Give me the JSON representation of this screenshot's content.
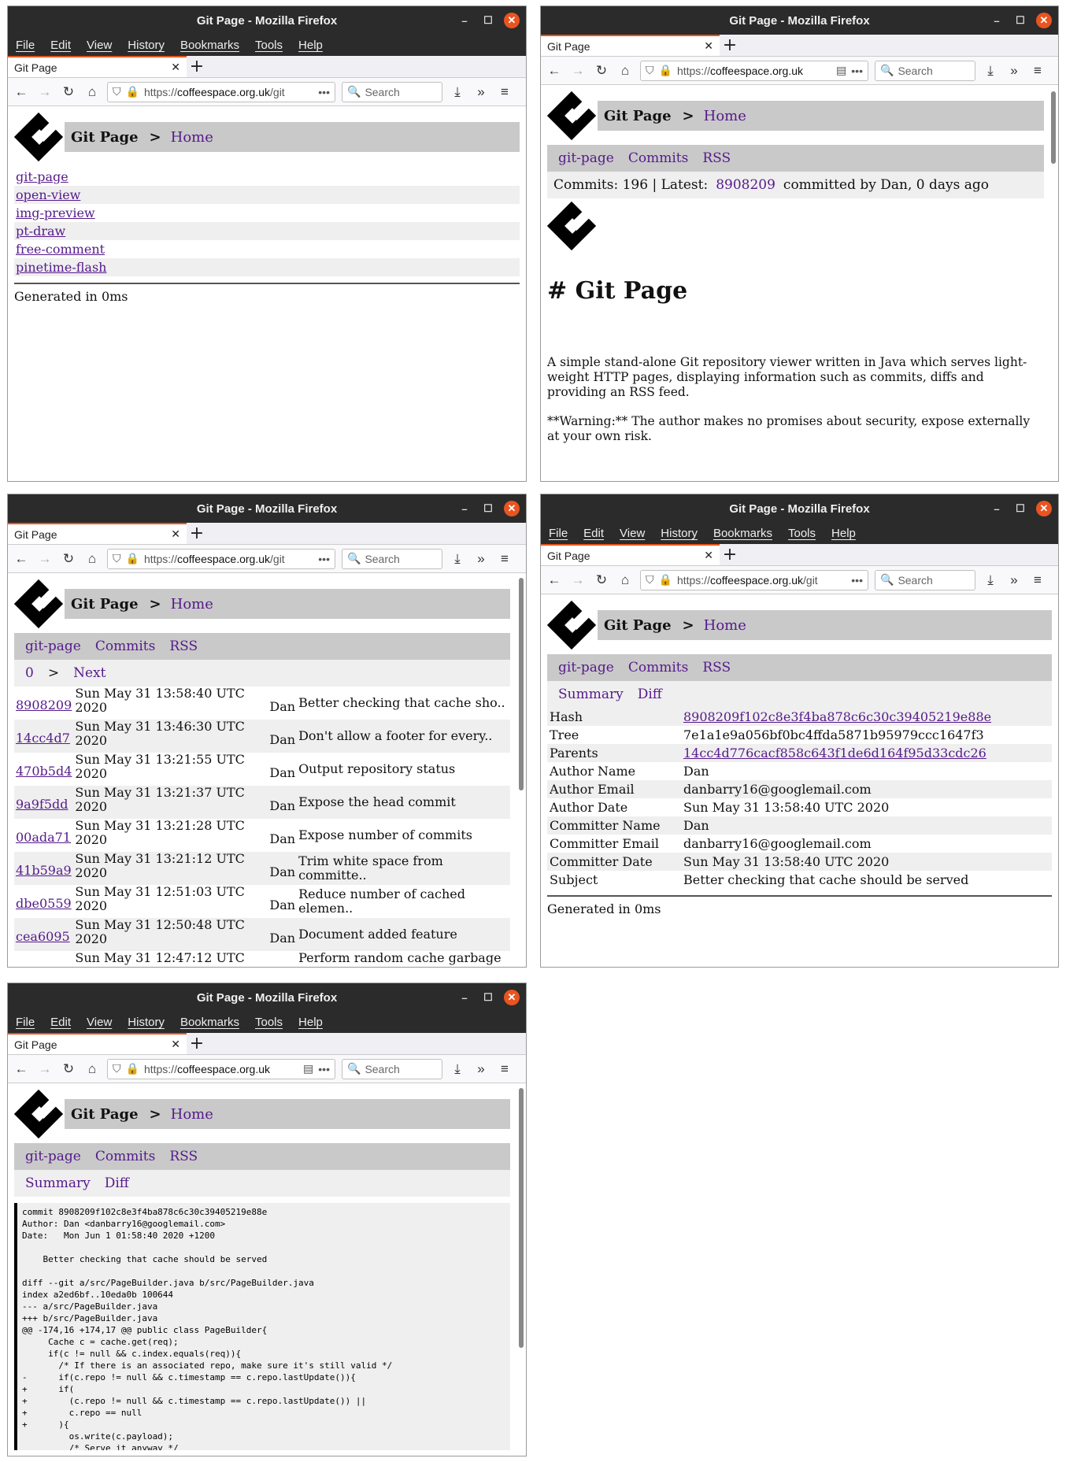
{
  "browser": {
    "window_title": "Git Page - Mozilla Firefox",
    "menu": [
      "File",
      "Edit",
      "View",
      "History",
      "Bookmarks",
      "Tools",
      "Help"
    ],
    "tab_title": "Git Page",
    "url_prefix": "https://",
    "url_host": "coffeespace.org.uk",
    "url_path": "/git",
    "search_placeholder": "Search",
    "accent_color": "#e95420"
  },
  "site": {
    "brand": "Git Page",
    "sep": ">",
    "home": "Home",
    "generated": "Generated in 0ms"
  },
  "w1": {
    "repos": [
      "git-page",
      "open-view",
      "img-preview",
      "pt-draw",
      "free-comment",
      "pinetime-flash"
    ]
  },
  "repo_nav": {
    "repo": "git-page",
    "commits": "Commits",
    "rss": "RSS"
  },
  "w2": {
    "summary_label": "Commits: 196 | Latest:",
    "latest_hash": "8908209",
    "summary_tail": "committed by Dan, 0 days ago",
    "readme_title": "# Git Page",
    "readme_p1": "A simple stand-alone Git repository viewer written in Java which serves light-weight HTTP pages, displaying information such as commits, diffs and providing an RSS feed.",
    "readme_p2": "**Warning:** The author makes no promises about security, expose externally at your own risk."
  },
  "w3": {
    "pager_num": "0",
    "pager_sep": ">",
    "pager_next": "Next",
    "commits": [
      {
        "hash": "8908209",
        "date": "Sun May 31 13:58:40 UTC 2020",
        "author": "Dan",
        "msg": "Better checking that cache sho.."
      },
      {
        "hash": "14cc4d7",
        "date": "Sun May 31 13:46:30 UTC 2020",
        "author": "Dan",
        "msg": "Don't allow a footer for every.."
      },
      {
        "hash": "470b5d4",
        "date": "Sun May 31 13:21:55 UTC 2020",
        "author": "Dan",
        "msg": "Output repository status"
      },
      {
        "hash": "9a9f5dd",
        "date": "Sun May 31 13:21:37 UTC 2020",
        "author": "Dan",
        "msg": "Expose the head commit"
      },
      {
        "hash": "00ada71",
        "date": "Sun May 31 13:21:28 UTC 2020",
        "author": "Dan",
        "msg": "Expose number of commits"
      },
      {
        "hash": "41b59a9",
        "date": "Sun May 31 13:21:12 UTC 2020",
        "author": "Dan",
        "msg": "Trim white space from committe.."
      },
      {
        "hash": "dbe0559",
        "date": "Sun May 31 12:51:03 UTC 2020",
        "author": "Dan",
        "msg": "Reduce number of cached elemen.."
      },
      {
        "hash": "cea6095",
        "date": "Sun May 31 12:50:48 UTC 2020",
        "author": "Dan",
        "msg": "Document added feature"
      },
      {
        "hash": "",
        "date": "Sun May 31 12:47:12 UTC",
        "author": "",
        "msg": "Perform random cache garbage"
      }
    ]
  },
  "commit_nav": {
    "summary": "Summary",
    "diff": "Diff"
  },
  "w4": {
    "rows": [
      {
        "k": "Hash",
        "v": "8908209f102c8e3f4ba878c6c30c39405219e88e",
        "link": true
      },
      {
        "k": "Tree",
        "v": "7e1a1e9a056bf0bc4ffda5871b95979ccc1647f3",
        "link": false
      },
      {
        "k": "Parents",
        "v": "14cc4d776cacf858c643f1de6d164f95d33cdc26",
        "link": true
      },
      {
        "k": "Author Name",
        "v": "Dan",
        "link": false
      },
      {
        "k": "Author Email",
        "v": "danbarry16@googlemail.com",
        "link": false
      },
      {
        "k": "Author Date",
        "v": "Sun May 31 13:58:40 UTC 2020",
        "link": false
      },
      {
        "k": "Committer Name",
        "v": "Dan",
        "link": false
      },
      {
        "k": "Committer Email",
        "v": "danbarry16@googlemail.com",
        "link": false
      },
      {
        "k": "Committer Date",
        "v": "Sun May 31 13:58:40 UTC 2020",
        "link": false
      },
      {
        "k": "Subject",
        "v": "Better checking that cache should be served",
        "link": false
      }
    ]
  },
  "w5": {
    "diff": "commit 8908209f102c8e3f4ba878c6c30c39405219e88e\nAuthor: Dan <danbarry16@googlemail.com>\nDate:   Mon Jun 1 01:58:40 2020 +1200\n\n    Better checking that cache should be served\n\ndiff --git a/src/PageBuilder.java b/src/PageBuilder.java\nindex a2ed6bf..10eda0b 100644\n--- a/src/PageBuilder.java\n+++ b/src/PageBuilder.java\n@@ -174,16 +174,17 @@ public class PageBuilder{\n     Cache c = cache.get(req);\n     if(c != null && c.index.equals(req)){\n       /* If there is an associated repo, make sure it's still valid */\n-      if(c.repo != null && c.timestamp == c.repo.lastUpdate()){\n+      if(\n+        (c.repo != null && c.timestamp == c.repo.lastUpdate()) ||\n+        c.repo == null\n+      ){\n         os.write(c.payload);\n         /* Serve it anyway */"
  }
}
